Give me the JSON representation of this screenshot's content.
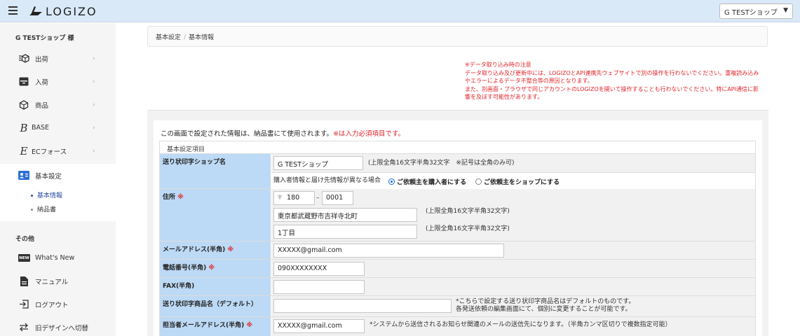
{
  "header": {
    "logo_text": "LOGIZO",
    "shop_select": "G TESTショップ"
  },
  "sidebar": {
    "user": "G TESTショップ 様",
    "items": [
      {
        "label": "出荷",
        "icon": "shipping-box-icon"
      },
      {
        "label": "入荷",
        "icon": "inbox-icon"
      },
      {
        "label": "商品",
        "icon": "product-cube-icon"
      },
      {
        "label": "BASE",
        "icon": "base-logo-icon"
      },
      {
        "label": "ECフォース",
        "icon": "ecforce-logo-icon"
      },
      {
        "label": "基本設定",
        "icon": "id-card-icon"
      }
    ],
    "sub_items": [
      "基本情報",
      "納品書"
    ],
    "other_section": "その他",
    "other_items": [
      {
        "label": "What's New",
        "icon": "new-badge-icon",
        "badge": "NEW"
      },
      {
        "label": "マニュアル",
        "icon": "document-icon"
      },
      {
        "label": "ログアウト",
        "icon": "logout-icon"
      },
      {
        "label": "旧デザインへ切替",
        "icon": "switch-arrows-icon"
      }
    ]
  },
  "breadcrumb": {
    "parent": "基本設定",
    "separator": "/",
    "current": "基本情報"
  },
  "notice": [
    "※データ取り込み時の注意",
    "データ取り込み及び更新中には、LOGIZOとAPI連携先ウェブサイトで別の操作を行わないでください。重複読み込みやエラーによるデータ不整合等の原因となります。",
    "また、別画面・ブラウザで同じアカウントのLOGIZOを開いて操作することも行わないでください。特にAPI通信に影響を及ぼす可能性があります。"
  ],
  "intro": {
    "text": "この画面で設定された情報は、納品書にて使用されます。",
    "req_note": "※は入力必須項目です。"
  },
  "section_title": "基本設定項目",
  "req_mark": "※",
  "form": {
    "shop_name": {
      "label": "送り状印字ショップ名",
      "value": "G TESTショップ",
      "hint": "(上限全角16文字半角32文字　※記号は全角のみ可)"
    },
    "requester": {
      "question": "購入者情報と届け先情報が異なる場合",
      "option1": "ご依頼主を購入者にする",
      "option2": "ご依頼主をショップにする",
      "selected": "option1"
    },
    "address": {
      "label": "住所",
      "postal_mark": "〒",
      "zip1": "180",
      "zip_sep": "–",
      "zip2": "0001",
      "line1": "東京都武蔵野市吉祥寺北町",
      "line1_hint": "(上限全角16文字半角32文字)",
      "line2": "1丁目",
      "line2_hint": "(上限全角16文字半角32文字)"
    },
    "email": {
      "label": "メールアドレス(半角)",
      "value": "XXXXX@gmail.com"
    },
    "phone": {
      "label": "電話番号(半角)",
      "value": "090XXXXXXXX"
    },
    "fax": {
      "label": "FAX(半角)",
      "value": ""
    },
    "product_name": {
      "label": "送り状印字商品名（デフォルト）",
      "value": "",
      "hint1": "*こちらで設定する送り状印字商品名はデフォルトのものです。",
      "hint2": "各発送依頼の編集画面にて、個別に変更することが可能です。"
    },
    "staff_email": {
      "label": "担当者メールアドレス(半角)",
      "value": "XXXXX@gmail.com",
      "hint": "*システムから送信されるお知らせ関連のメールの送信先になります。（半角カンマ区切りで複数指定可能）"
    }
  }
}
